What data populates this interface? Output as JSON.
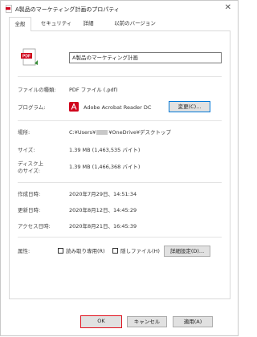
{
  "window": {
    "title": "A製品のマーケティング計画のプロパティ",
    "close_glyph": "✕"
  },
  "tabs": [
    {
      "label": "全般",
      "active": true
    },
    {
      "label": "セキュリティ",
      "active": false
    },
    {
      "label": "詳細",
      "active": false
    },
    {
      "label": "以前のバージョン",
      "active": false
    }
  ],
  "file": {
    "name": "A製品のマーケティング計画",
    "icon": "pdf-file-icon",
    "icon_text": "PDF"
  },
  "fields": {
    "type_label": "ファイルの種類:",
    "type_value": "PDF ファイル (.pdf)",
    "program_label": "プログラム:",
    "program_value": "Adobe Acrobat Reader DC",
    "change_button": "変更(C)...",
    "location_label": "場所:",
    "location_prefix": "C:¥Users¥",
    "location_suffix": "¥OneDrive¥デスクトップ",
    "size_label": "サイズ:",
    "size_value": "1.39 MB (1,463,535 バイト)",
    "disk_label_1": "ディスク上",
    "disk_label_2": "のサイズ:",
    "disk_value": "1.39 MB (1,466,368 バイト)",
    "created_label": "作成日時:",
    "created_value": "2020年7月29日、14:51:34",
    "modified_label": "更新日時:",
    "modified_value": "2020年8月12日、14:45:29",
    "accessed_label": "アクセス日時:",
    "accessed_value": "2020年8月21日、16:45:39",
    "attr_label": "属性:",
    "readonly_label": "読み取り専用(R)",
    "hidden_label": "隠しファイル(H)",
    "advanced_button": "詳細設定(D)..."
  },
  "footer": {
    "ok": "OK",
    "cancel": "キャンセル",
    "apply": "適用(A)"
  },
  "colors": {
    "accent": "#0078d7",
    "ok_highlight": "#e0121f",
    "pdf_red": "#d0021b"
  }
}
